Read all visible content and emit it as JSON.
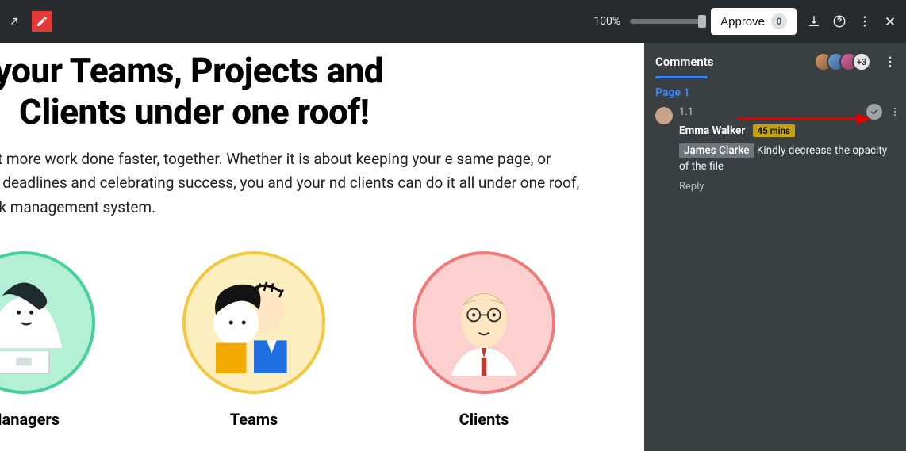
{
  "toolbar": {
    "zoom": "100%",
    "approve_label": "Approve",
    "approve_count": "0"
  },
  "main": {
    "title_line1": "All your Teams, Projects and",
    "title_line2": "Clients under one roof!",
    "subtitle": "ub you can get more work done faster, together. Whether it is about keeping your e same page, or committing to deadlines and celebrating success, you and your nd clients can do it all under one roof, using one work management system.",
    "cards": [
      {
        "label": "Managers"
      },
      {
        "label": "Teams"
      },
      {
        "label": "Clients"
      }
    ]
  },
  "panel": {
    "title": "Comments",
    "more_avatars": "+3",
    "page_label": "Page 1",
    "comment": {
      "number": "1.1",
      "author": "Emma Walker",
      "time": "45 mins",
      "mention": "James Clarke",
      "text": "Kindly decrease the opacity of the file",
      "reply_label": "Reply"
    }
  }
}
